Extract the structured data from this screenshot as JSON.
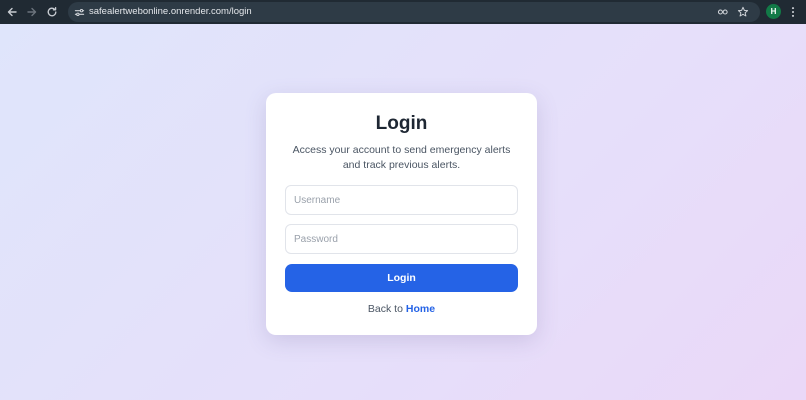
{
  "browser": {
    "url": "safealertwebonline.onrender.com/login",
    "profile_initial": "H",
    "profile_color": "#127a47"
  },
  "login": {
    "title": "Login",
    "description": "Access your account to send emergency alerts and track previous alerts.",
    "username_placeholder": "Username",
    "password_placeholder": "Password",
    "submit_label": "Login",
    "back_prefix": "Back to",
    "home_link": "Home"
  },
  "colors": {
    "primary": "#2563e6",
    "title": "#1e2733",
    "body_text": "#4a5563"
  },
  "icons": [
    "back-arrow-icon",
    "forward-arrow-icon",
    "reload-icon",
    "site-settings-icon",
    "password-key-icon",
    "bookmark-star-icon",
    "menu-dots-icon"
  ]
}
